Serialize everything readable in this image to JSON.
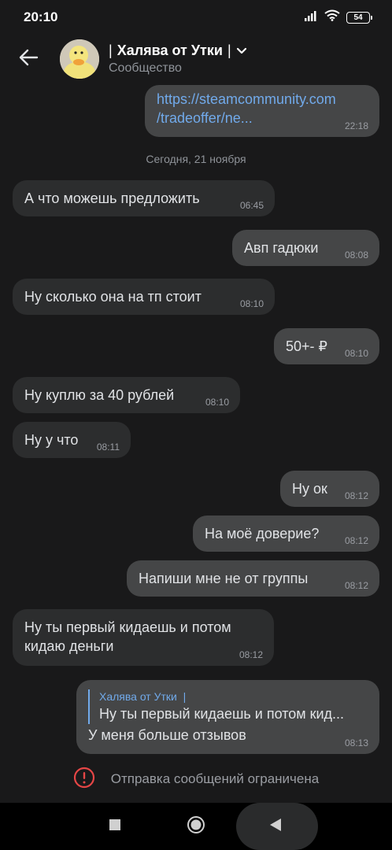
{
  "status_bar": {
    "time": "20:10",
    "battery": "54"
  },
  "header": {
    "title": "Халява от Утки",
    "subtitle": "Сообщество"
  },
  "chat": {
    "link_message": {
      "line1": "https://steamcommunity.com",
      "line2": "/tradeoffer/ne...",
      "time": "22:18"
    },
    "date_separator": "Сегодня, 21 ноября",
    "messages": [
      {
        "direction": "in",
        "text": "А что можешь предложить",
        "time": "06:45"
      },
      {
        "direction": "out",
        "text": "Авп гадюки",
        "time": "08:08"
      },
      {
        "direction": "in",
        "text": "Ну сколько она на тп стоит",
        "time": "08:10"
      },
      {
        "direction": "out",
        "text": "50+- ₽",
        "time": "08:10"
      },
      {
        "direction": "in",
        "text": "Ну куплю за 40 рублей",
        "time": "08:10"
      },
      {
        "direction": "in",
        "text": "Ну у что",
        "time": "08:11"
      },
      {
        "direction": "out",
        "text": "Ну ок",
        "time": "08:12"
      },
      {
        "direction": "out",
        "text": "На моё доверие?",
        "time": "08:12"
      },
      {
        "direction": "out",
        "text": "Напиши мне не от группы",
        "time": "08:12"
      },
      {
        "direction": "in",
        "text_line1": "Ну ты первый кидаешь и потом",
        "text_line2": "кидаю деньги",
        "time": "08:12"
      }
    ],
    "reply_message": {
      "quote_author": "Халява от Утки",
      "quote_text": "Ну ты первый кидаешь и потом кид...",
      "text": "У меня больше отзывов",
      "time": "08:13"
    }
  },
  "footer": {
    "restricted_text": "Отправка сообщений ограничена"
  },
  "colors": {
    "background": "#19191a",
    "incoming_bubble": "#2c2d2e",
    "outgoing_bubble": "#454647",
    "link": "#71aaeb",
    "warning": "#e64646"
  }
}
